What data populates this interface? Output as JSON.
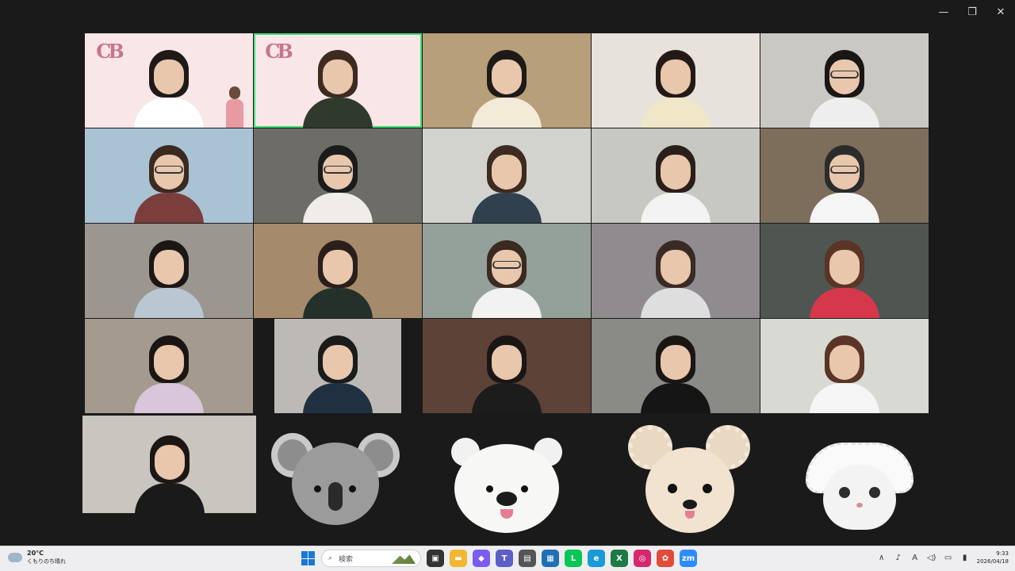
{
  "window": {
    "controls": [
      {
        "name": "minimize",
        "glyph": "—"
      },
      {
        "name": "restore",
        "glyph": "❐"
      },
      {
        "name": "close",
        "glyph": "✕"
      }
    ]
  },
  "video_grid": {
    "rows": 4,
    "cols": 5,
    "tiles": [
      {
        "bg": "#f9e6e6",
        "hair": "#1f1a18",
        "top": "#ffffff",
        "logo": true,
        "figure": true
      },
      {
        "bg": "#f9e6e6",
        "hair": "#3d2b20",
        "top": "#2f3a2d",
        "logo": true,
        "active": true
      },
      {
        "bg": "#b79f7a",
        "hair": "#1f1a18",
        "top": "#f4ead8"
      },
      {
        "bg": "#e7e2dc",
        "hair": "#231a16",
        "top": "#f0e6c8"
      },
      {
        "bg": "#c9c8c2",
        "hair": "#1a1614",
        "top": "#eeeeee",
        "glasses": true
      },
      {
        "bg": "#a9c3d4",
        "hair": "#3a2a20",
        "top": "#7b3e3c",
        "glasses": true
      },
      {
        "bg": "#6d6c66",
        "hair": "#1b1b1b",
        "top": "#f0ecea",
        "glasses": true
      },
      {
        "bg": "#d2d3cf",
        "hair": "#3d2a20",
        "top": "#30404f"
      },
      {
        "bg": "#c8c8c2",
        "hair": "#2a1f1a",
        "top": "#f3f3f3"
      },
      {
        "bg": "#7d6e5b",
        "hair": "#2b2b2b",
        "top": "#f5f5f5",
        "glasses": true
      },
      {
        "bg": "#9c9690",
        "hair": "#1c1715",
        "top": "#b9c7d3"
      },
      {
        "bg": "#a58b6c",
        "hair": "#2a1f1a",
        "top": "#24302a"
      },
      {
        "bg": "#93a19a",
        "hair": "#3a2a20",
        "top": "#f2f2f2",
        "glasses": true
      },
      {
        "bg": "#8f8b8e",
        "hair": "#3a2a24",
        "top": "#dedede"
      },
      {
        "bg": "#4f5652",
        "hair": "#5a3424",
        "top": "#d6384b"
      },
      {
        "bg": "#a49a8e",
        "hair": "#1a1614",
        "top": "#d9c6da"
      },
      {
        "bg": "#bdbab6",
        "hair": "#1b1b1b",
        "top": "#203040",
        "narrow": true
      },
      {
        "bg": "#5d4238",
        "hair": "#1a1614",
        "top": "#1c1c1c"
      },
      {
        "bg": "#8a8a86",
        "hair": "#1a1614",
        "top": "#151515"
      },
      {
        "bg": "#d9d9d4",
        "hair": "#5a3424",
        "top": "#f5f5f5"
      }
    ],
    "bottom_person": {
      "bg": "#c9c5bf",
      "hair": "#1c1715",
      "top": "#1a1a1a"
    },
    "avatars": [
      "koala-avatar",
      "polar-bear-avatar",
      "teddy-puppy-avatar",
      "bonnet-kitten-avatar"
    ]
  },
  "taskbar": {
    "weather": {
      "temp": "20°C",
      "desc": "くもりのち晴れ"
    },
    "search_placeholder": "検索",
    "apps": [
      {
        "name": "task-view-icon",
        "color": "#333333",
        "glyph": "▣"
      },
      {
        "name": "file-explorer-icon",
        "color": "#f2b632",
        "glyph": "▬"
      },
      {
        "name": "copilot-icon",
        "color": "#7b5cf0",
        "glyph": "◆"
      },
      {
        "name": "teams-icon",
        "color": "#5b5fc7",
        "glyph": "T"
      },
      {
        "name": "printer-icon",
        "color": "#555555",
        "glyph": "▤"
      },
      {
        "name": "store-icon",
        "color": "#1f6fb4",
        "glyph": "▦"
      },
      {
        "name": "line-icon",
        "color": "#06c755",
        "glyph": "L"
      },
      {
        "name": "edge-icon",
        "color": "#1a9ad6",
        "glyph": "e"
      },
      {
        "name": "excel-icon",
        "color": "#1d7a45",
        "glyph": "X"
      },
      {
        "name": "instagram-icon",
        "color": "#d6286e",
        "glyph": "◎"
      },
      {
        "name": "photos-icon",
        "color": "#e24b3a",
        "glyph": "✿"
      },
      {
        "name": "zoom-icon",
        "color": "#2d8cff",
        "glyph": "zm"
      }
    ],
    "tray": {
      "symbols": [
        {
          "name": "chevron-up-icon",
          "glyph": "∧"
        },
        {
          "name": "microphone-icon",
          "glyph": "♪"
        },
        {
          "name": "ime-icon",
          "glyph": "A"
        },
        {
          "name": "volume-icon",
          "glyph": "◁)"
        },
        {
          "name": "display-icon",
          "glyph": "▭"
        },
        {
          "name": "battery-icon",
          "glyph": "▮"
        }
      ],
      "time": "9:33",
      "date": "2026/04/18"
    }
  }
}
